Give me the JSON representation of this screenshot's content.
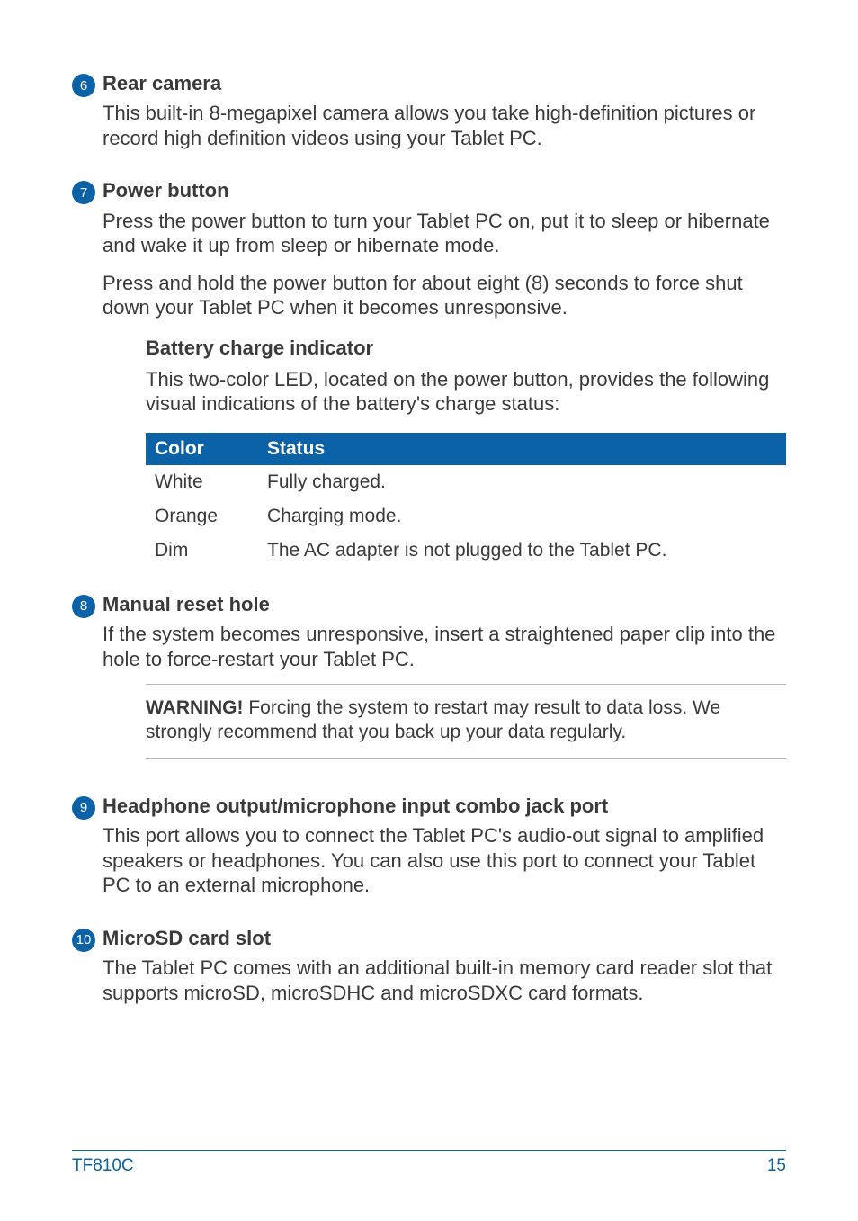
{
  "items": [
    {
      "num": "6",
      "title": "Rear camera",
      "paragraphs": [
        "This built-in 8-megapixel camera allows you take high-definition pictures or record high definition videos using your Tablet PC."
      ]
    },
    {
      "num": "7",
      "title": "Power button",
      "paragraphs": [
        "Press the power button to turn your Tablet PC on, put it to sleep or hibernate and wake it up from sleep or hibernate mode.",
        "Press and hold the power button for about eight (8) seconds to force shut down your Tablet PC when it becomes unresponsive."
      ],
      "sub": {
        "title": "Battery charge indicator",
        "desc": "This two-color LED, located on the power button, provides the following visual indications of the battery's charge status:",
        "table": {
          "head": {
            "c0": "Color",
            "c1": "Status"
          },
          "rows": [
            {
              "c0": "White",
              "c1": "Fully charged."
            },
            {
              "c0": "Orange",
              "c1": "Charging mode."
            },
            {
              "c0": "Dim",
              "c1": "The AC adapter is not plugged to the Tablet PC."
            }
          ]
        }
      }
    },
    {
      "num": "8",
      "title": "Manual reset hole",
      "paragraphs": [
        "If the system becomes unresponsive, insert a straightened paper clip into the hole to force-restart your Tablet PC."
      ],
      "warning": {
        "label": "WARNING!",
        "text": "  Forcing the system to restart may result to data loss. We strongly recommend that you back up your data regularly."
      }
    },
    {
      "num": "9",
      "title": "Headphone output/microphone input combo jack port",
      "paragraphs": [
        "This port allows you to connect the Tablet PC's audio-out signal to amplified speakers or headphones. You can also use this port to connect your Tablet PC to an external microphone."
      ]
    },
    {
      "num": "10",
      "title": "MicroSD card slot",
      "paragraphs": [
        "The Tablet PC comes with an additional built-in memory card reader slot that supports microSD, microSDHC and microSDXC card formats."
      ]
    }
  ],
  "footer": {
    "model": "TF810C",
    "page": "15"
  }
}
